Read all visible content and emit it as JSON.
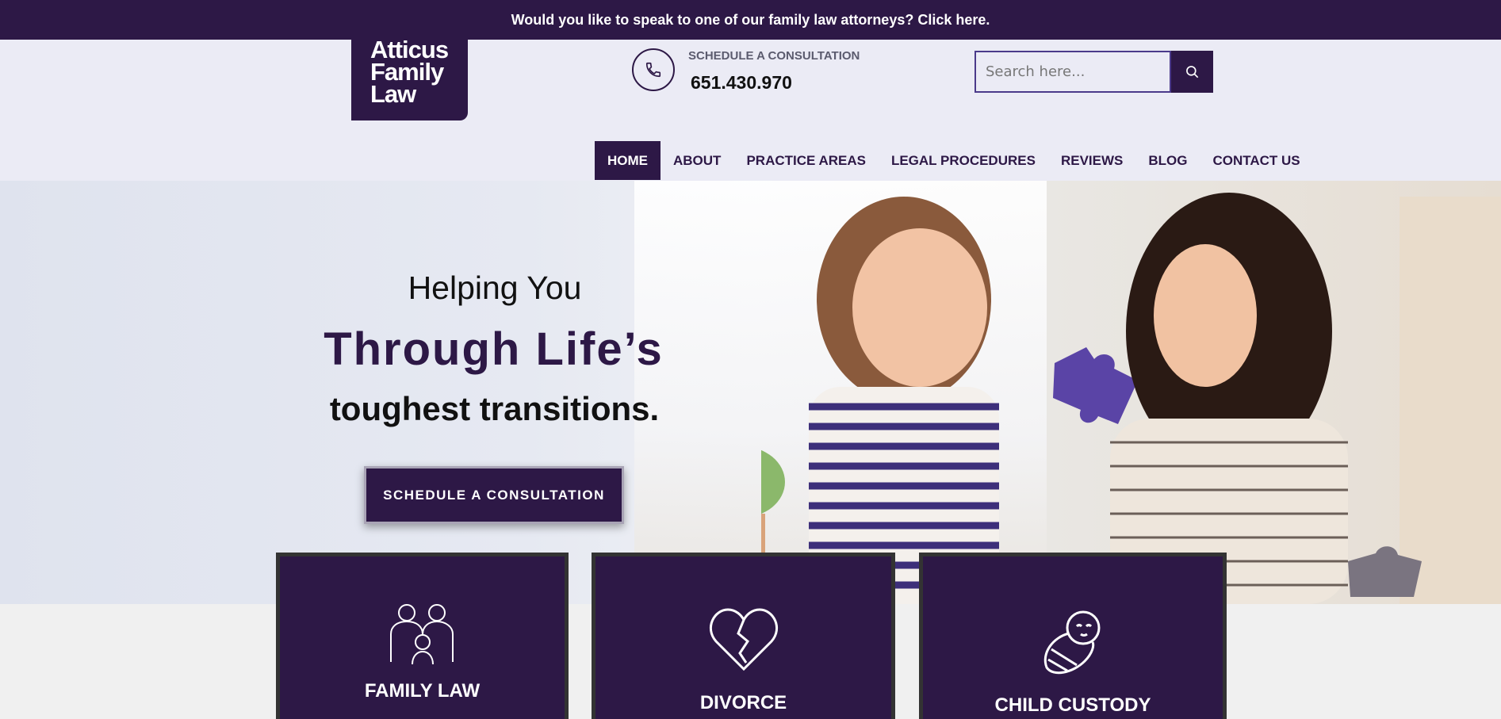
{
  "announcement": "Would you like to speak to one of our family law attorneys? Click here.",
  "logo": {
    "line1": "Atticus",
    "line2": "Family",
    "line3": "Law"
  },
  "contact": {
    "label": "SCHEDULE A CONSULTATION",
    "phone": "651.430.970",
    "icon": "phone-icon"
  },
  "search": {
    "placeholder": "Search here...",
    "icon": "search-icon"
  },
  "nav": {
    "items": [
      {
        "label": "HOME",
        "active": true
      },
      {
        "label": "ABOUT"
      },
      {
        "label": "PRACTICE AREAS"
      },
      {
        "label": "LEGAL PROCEDURES"
      },
      {
        "label": "REVIEWS"
      },
      {
        "label": "BLOG"
      },
      {
        "label": "CONTACT US"
      }
    ]
  },
  "hero": {
    "line1": "Helping You",
    "line2": "Through Life’s",
    "line3": "toughest transitions.",
    "cta": "SCHEDULE A CONSULTATION"
  },
  "cards": [
    {
      "title": "FAMILY LAW",
      "icon": "family-icon"
    },
    {
      "title": "DIVORCE",
      "icon": "broken-heart-icon"
    },
    {
      "title": "CHILD CUSTODY",
      "icon": "baby-icon"
    }
  ],
  "colors": {
    "brand": "#2d1846",
    "header_bg": "#ebebf5"
  }
}
